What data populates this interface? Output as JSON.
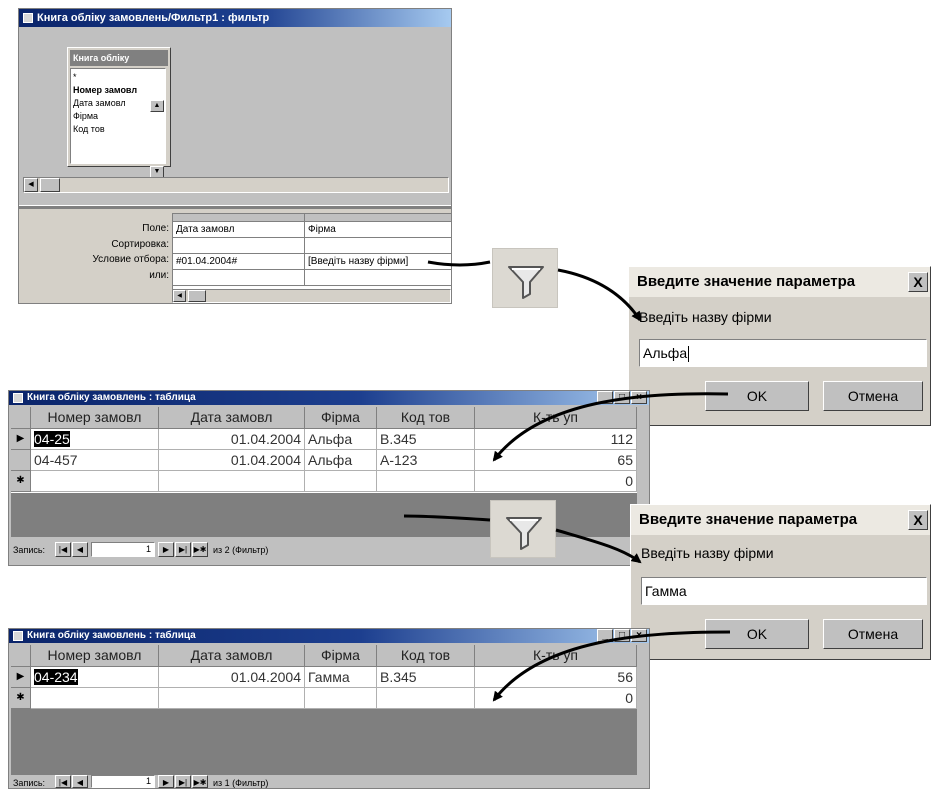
{
  "query_window": {
    "title": "Книга обліку замовлень/Фильтр1 : фильтр",
    "field_list": {
      "title": "Книга обліку",
      "items": [
        "*",
        "Номер замовл",
        "Дата замовл",
        "Фірма",
        "Код тов"
      ]
    },
    "row_labels": {
      "field": "Поле:",
      "sort": "Сортировка:",
      "criteria": "Условие отбора:",
      "or": "или:"
    },
    "columns": [
      {
        "field": "Дата замовл",
        "criteria": "#01.04.2004#"
      },
      {
        "field": "Фірма",
        "criteria": "[Введіть назву фірми]"
      }
    ]
  },
  "dialog1": {
    "title": "Введите значение параметра",
    "close": "X",
    "prompt": "Введіть назву фірми",
    "value": "Альфа",
    "ok": "OK",
    "cancel": "Отмена"
  },
  "dialog2": {
    "title": "Введите значение параметра",
    "close": "X",
    "prompt": "Введіть назву фірми",
    "value": "Гамма",
    "ok": "OK",
    "cancel": "Отмена"
  },
  "table1": {
    "title": "Книга обліку замовлень : таблица",
    "headers": [
      "Номер замовл",
      "Дата замовл",
      "Фірма",
      "Код тов",
      "К-ть уп"
    ],
    "rows": [
      {
        "num": "04-25",
        "date": "01.04.2004",
        "firm": "Альфа",
        "code": "B.345",
        "qty": "112"
      },
      {
        "num": "04-457",
        "date": "01.04.2004",
        "firm": "Альфа",
        "code": "A-123",
        "qty": "65"
      }
    ],
    "new_row_qty": "0",
    "nav": {
      "label": "Запись:",
      "current": "1",
      "of": "из 2 (Фильтр)"
    }
  },
  "table2": {
    "title": "Книга обліку замовлень : таблица",
    "headers": [
      "Номер замовл",
      "Дата замовл",
      "Фірма",
      "Код тов",
      "К-ть уп"
    ],
    "rows": [
      {
        "num": "04-234",
        "date": "01.04.2004",
        "firm": "Гамма",
        "code": "B.345",
        "qty": "56"
      }
    ],
    "new_row_qty": "0",
    "nav": {
      "label": "Запись:",
      "current": "1",
      "of": "из 1 (Фильтр)"
    }
  },
  "colors": {
    "title_bar": "#0a246a",
    "window_face": "#c0c0c0",
    "dialog_face": "#d4d0c8"
  },
  "icons": {
    "filter": "funnel-icon",
    "arrow": "curved-arrow"
  }
}
